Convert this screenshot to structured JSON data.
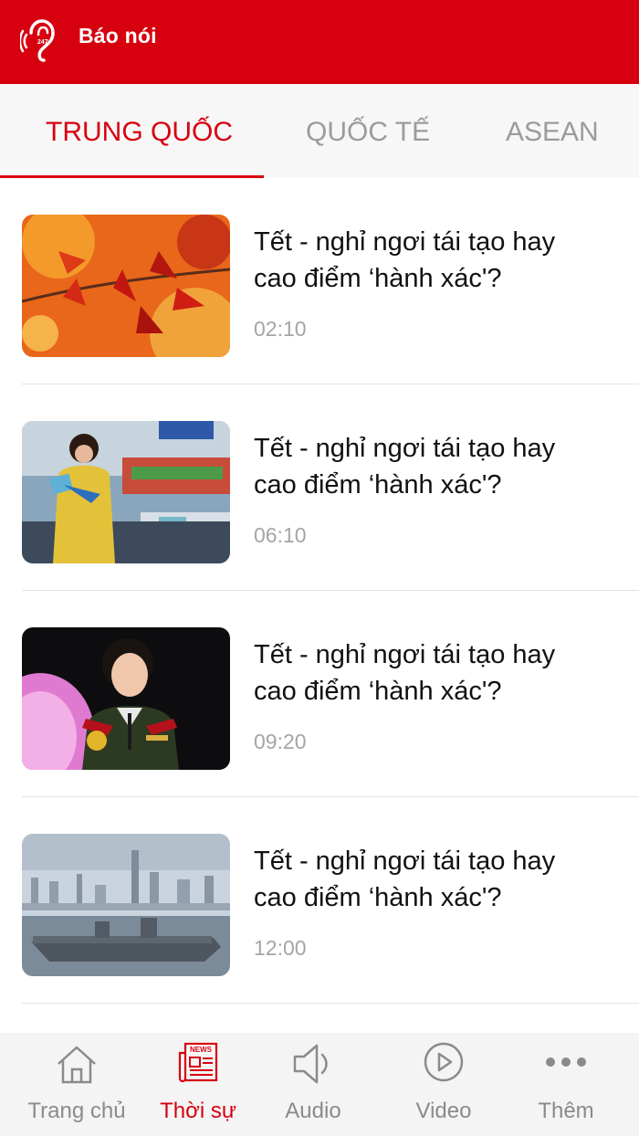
{
  "header": {
    "app_title": "Báo nói",
    "logo_icon": "ear-sound-icon",
    "logo_badge": "247",
    "color": "#d7000f"
  },
  "tabs": [
    {
      "label": "TRUNG QUỐC",
      "active": true
    },
    {
      "label": "QUỐC TẾ",
      "active": false
    },
    {
      "label": "ASEAN",
      "active": false
    }
  ],
  "articles": [
    {
      "title_line1": "Tết - nghỉ ngơi tái tạo hay",
      "title_line2": "cao điểm ‘hành xác'?",
      "duration": "02:10",
      "thumb": "red-leaves-photo"
    },
    {
      "title_line1": "Tết - nghỉ ngơi tái tạo hay",
      "title_line2": "cao điểm ‘hành xác'?",
      "duration": "06:10",
      "thumb": "woman-at-book-fair-photo"
    },
    {
      "title_line1": "Tết - nghỉ ngơi tái tạo hay",
      "title_line2": "cao điểm ‘hành xác'?",
      "duration": "09:20",
      "thumb": "woman-in-uniform-photo"
    },
    {
      "title_line1": "Tết - nghỉ ngơi tái tạo hay",
      "title_line2": "cao điểm ‘hành xác'?",
      "duration": "12:00",
      "thumb": "aircraft-carrier-photo"
    }
  ],
  "bottom_nav": [
    {
      "label": "Trang chủ",
      "icon": "home-icon",
      "active": false
    },
    {
      "label": "Thời sự",
      "icon": "news-icon",
      "icon_text": "NEWS",
      "active": true
    },
    {
      "label": "Audio",
      "icon": "speaker-icon",
      "active": false
    },
    {
      "label": "Video",
      "icon": "play-icon",
      "active": false
    },
    {
      "label": "Thêm",
      "icon": "more-icon",
      "active": false
    }
  ],
  "colors": {
    "accent": "#d7000f",
    "inactive": "#8a8a8a",
    "nav_bg": "#f4f4f4",
    "tabs_bg": "#f7f7f7"
  }
}
